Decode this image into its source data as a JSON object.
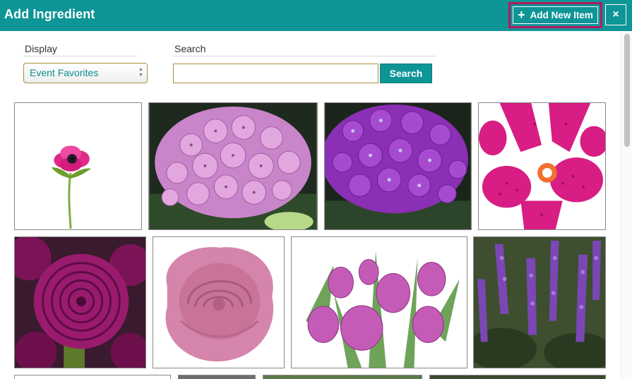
{
  "header": {
    "title": "Add Ingredient",
    "add_new_label": "Add New Item",
    "close_label": "×"
  },
  "filters": {
    "display_label": "Display",
    "display_selected": "Event Favorites",
    "search_label": "Search",
    "search_value": "",
    "search_button": "Search"
  },
  "colors": {
    "header_bg": "#0e9596",
    "accent_border": "#b5195f",
    "field_border": "#a88f3b"
  },
  "gallery": {
    "items": [
      {
        "name": "pink anemone"
      },
      {
        "name": "pink hydrangea"
      },
      {
        "name": "purple hydrangea"
      },
      {
        "name": "pink orchid"
      },
      {
        "name": "magenta ranunculus"
      },
      {
        "name": "pink rose"
      },
      {
        "name": "pink tulips"
      },
      {
        "name": "purple veronica"
      }
    ]
  }
}
